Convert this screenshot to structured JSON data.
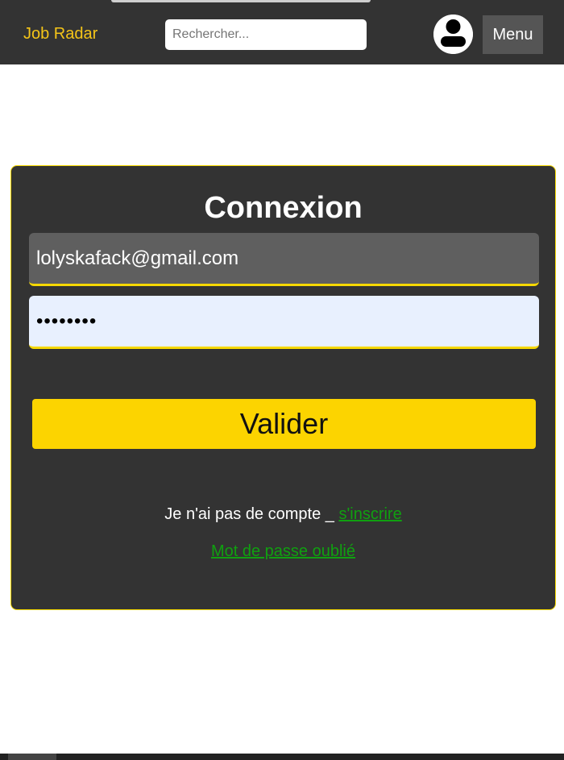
{
  "header": {
    "brand": "Job Radar",
    "search_placeholder": "Rechercher...",
    "avatar_icon": "user-avatar-icon",
    "menu_label": "Menu"
  },
  "login": {
    "title": "Connexion",
    "email_value": "lolyskafack@gmail.com",
    "password_value": "••••••••",
    "submit_label": "Valider",
    "no_account_text": "Je n'ai pas de compte _ ",
    "signup_link": "s'inscrire",
    "forgot_link": "Mot de passe oublié"
  },
  "colors": {
    "header_bg": "#333333",
    "accent_yellow": "#fcd400",
    "brand_color": "#f5c518",
    "link_green": "#10a010"
  }
}
